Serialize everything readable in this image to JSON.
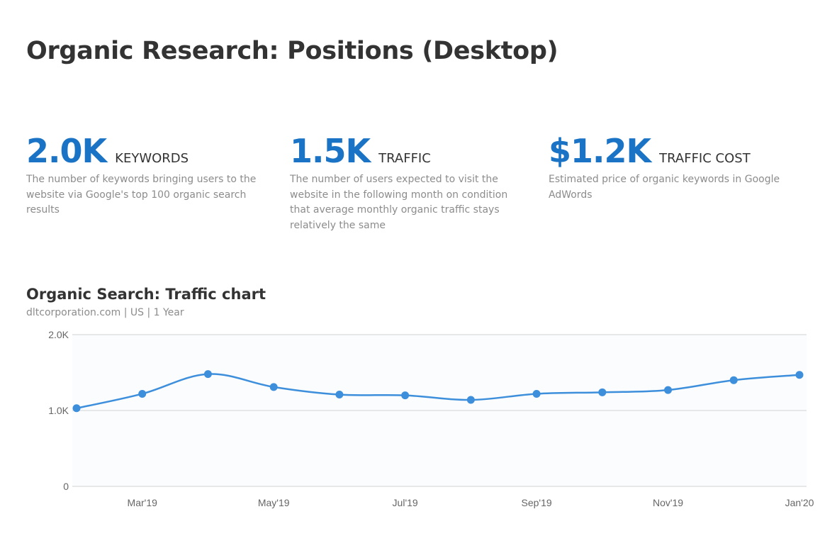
{
  "title": "Organic Research: Positions (Desktop)",
  "metrics": [
    {
      "value": "2.0K",
      "label": "KEYWORDS",
      "description": "The number of keywords bringing users to the website via Google's top 100 organic search results"
    },
    {
      "value": "1.5K",
      "label": "TRAFFIC",
      "description": "The number of users expected to visit the website in the following month on condition that average monthly organic traffic stays relatively the same"
    },
    {
      "value": "$1.2K",
      "label": "TRAFFIC COST",
      "description": "Estimated price of organic keywords in Google AdWords"
    }
  ],
  "chart_title": "Organic Search: Traffic chart",
  "chart_subtitle": "dltcorporation.com | US | 1 Year",
  "colors": {
    "accent": "#1a73c5",
    "line": "#3d8fdc",
    "grid": "#e0e0e0"
  },
  "chart_data": {
    "type": "line",
    "title": "Organic Search: Traffic chart",
    "xlabel": "",
    "ylabel": "",
    "x": [
      "Feb'19",
      "Mar'19",
      "Apr'19",
      "May'19",
      "Jun'19",
      "Jul'19",
      "Aug'19",
      "Sep'19",
      "Oct'19",
      "Nov'19",
      "Dec'19",
      "Jan'20"
    ],
    "x_tick_labels": [
      "Mar'19",
      "May'19",
      "Jul'19",
      "Sep'19",
      "Nov'19",
      "Jan'20"
    ],
    "y_ticks": [
      {
        "value": 0,
        "label": "0"
      },
      {
        "value": 1000,
        "label": "1.0K"
      },
      {
        "value": 2000,
        "label": "2.0K"
      }
    ],
    "ylim": [
      0,
      2000
    ],
    "grid": true,
    "series": [
      {
        "values": [
          1030,
          1220,
          1480,
          1310,
          1210,
          1200,
          1140,
          1220,
          1240,
          1270,
          1400,
          1470
        ]
      }
    ]
  }
}
